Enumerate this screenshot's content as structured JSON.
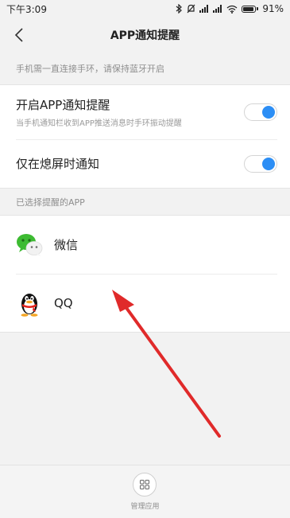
{
  "status_bar": {
    "time": "下午3:09",
    "battery_percent": "91%",
    "battery_level": 0.91
  },
  "header": {
    "title": "APP通知提醒"
  },
  "hint": {
    "text": "手机需一直连接手环，请保持蓝牙开启"
  },
  "settings": [
    {
      "title": "开启APP通知提醒",
      "subtitle": "当手机通知栏收到APP推送消息时手环振动提醒",
      "enabled": true
    },
    {
      "title": "仅在熄屏时通知",
      "subtitle": "",
      "enabled": true
    }
  ],
  "apps_section": {
    "label": "已选择提醒的APP",
    "apps": [
      {
        "name": "微信",
        "icon": "wechat-icon"
      },
      {
        "name": "QQ",
        "icon": "qq-icon"
      }
    ]
  },
  "bottom_bar": {
    "manage_label": "管理应用",
    "icon": "grid-icon"
  },
  "colors": {
    "accent": "#2c8ef5",
    "arrow": "#e02a2a",
    "wechat": "#3dbb32"
  }
}
